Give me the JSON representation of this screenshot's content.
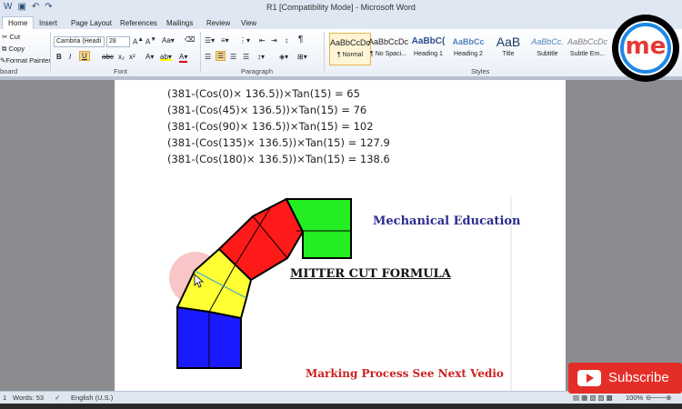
{
  "window": {
    "title": "R1 [Compatibility Mode] - Microsoft Word"
  },
  "tabs": [
    "Home",
    "Insert",
    "Page Layout",
    "References",
    "Mailings",
    "Review",
    "View"
  ],
  "ribbon": {
    "clipboard": {
      "cut": "Cut",
      "copy": "Copy",
      "format_painter": "Format Painter",
      "label": "board"
    },
    "font": {
      "name": "Cambria (Headi",
      "size": "28",
      "label": "Font"
    },
    "paragraph": {
      "label": "Paragraph"
    },
    "styles": {
      "label": "Styles",
      "items": [
        {
          "sample": "AaBbCcDc",
          "name": "¶ Normal"
        },
        {
          "sample": "AaBbCcDc",
          "name": "¶ No Spaci..."
        },
        {
          "sample": "AaBbC(",
          "name": "Heading 1"
        },
        {
          "sample": "AaBbCc",
          "name": "Heading 2"
        },
        {
          "sample": "AaB",
          "name": "Title"
        },
        {
          "sample": "AaBbCc.",
          "name": "Subtitle"
        },
        {
          "sample": "AaBbCcDc",
          "name": "Subtle Em..."
        }
      ]
    }
  },
  "document": {
    "formulas": [
      "(381-(Cos(0)× 136.5))×Tan(15) = 65",
      "(381-(Cos(45)× 136.5))×Tan(15) = 76",
      "(381-(Cos(90)× 136.5))×Tan(15) = 102",
      "(381-(Cos(135)× 136.5))×Tan(15) = 127.9",
      "(381-(Cos(180)× 136.5))×Tan(15) = 138.6"
    ],
    "diagram": {
      "brand": "Mechanical Education",
      "heading": "MITTER CUT FORMULA",
      "footer": "Marking Process See Next Vedio"
    }
  },
  "status": {
    "page": "1",
    "words": "Words: 53",
    "language": "English (U.S.)",
    "zoom": "100%"
  },
  "overlay": {
    "subscribe": "Subscribe",
    "logo": "me"
  },
  "colors": {
    "segment_blue": "#1a1aff",
    "segment_yellow": "#ffff33",
    "segment_red": "#ff1a1a",
    "segment_green": "#22ee22",
    "brand_text": "#2b2b8f",
    "footer_text": "#cc2222"
  }
}
